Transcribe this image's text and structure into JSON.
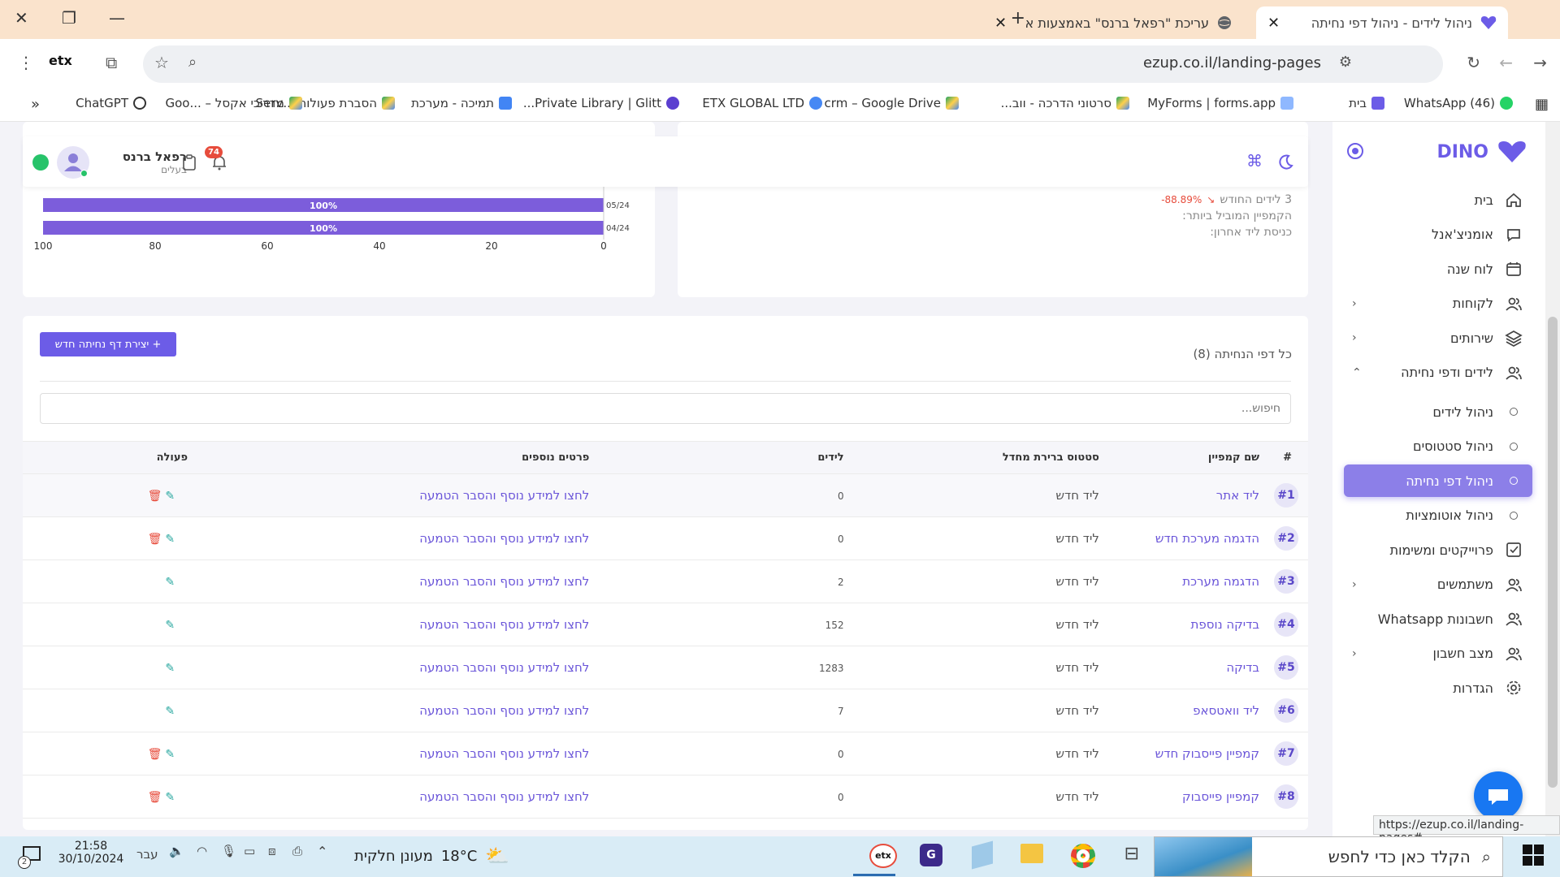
{
  "browser": {
    "tabs": [
      {
        "title": "ניהול לידים - ניהול דפי נחיתה",
        "active": true
      },
      {
        "title": "עריכת \"רפאל ברנס\" באמצעות א",
        "active": false
      }
    ],
    "url": "ezup.co.il/landing-pages",
    "bookmarks": [
      "(46) WhatsApp",
      "בית",
      "MyForms | forms.app",
      "סרטוני הדרכה - ווב...",
      "crm – Google Drive",
      "ETX GLOBAL LTD",
      "Private Library | Glitt...",
      "תמיכה - מערכת",
      "הסברת פעולות ...Serv",
      "מדריכי אקסל – ...Goo",
      "ChatGPT"
    ],
    "status_url": "https://ezup.co.il/landing-pages#"
  },
  "sidebar": {
    "logo": "DINO",
    "items": [
      {
        "label": "בית",
        "icon": "home-icon",
        "chevron": false
      },
      {
        "label": "אומניצ'אנל",
        "icon": "chat-icon",
        "chevron": false
      },
      {
        "label": "לוח שנה",
        "icon": "calendar-icon",
        "chevron": false
      },
      {
        "label": "לקוחות",
        "icon": "users-icon",
        "chevron": true
      },
      {
        "label": "שירותים",
        "icon": "layers-icon",
        "chevron": true
      },
      {
        "label": "לידים ודפי נחיתה",
        "icon": "users-icon",
        "chevron": true,
        "open": true
      }
    ],
    "subitems": [
      {
        "label": "ניהול לידים",
        "active": false
      },
      {
        "label": "ניהול סטטוסים",
        "active": false
      },
      {
        "label": "ניהול דפי נחיתה",
        "active": true
      },
      {
        "label": "ניהול אוטומציות",
        "active": false
      }
    ],
    "items2": [
      {
        "label": "פרוייקטים ומשימות",
        "icon": "checkbox-icon",
        "chevron": false
      },
      {
        "label": "משתמשים",
        "icon": "users-icon",
        "chevron": true
      },
      {
        "label": "חשבונות Whatsapp",
        "icon": "users-icon",
        "chevron": false
      },
      {
        "label": "מצב חשבון",
        "icon": "users-icon",
        "chevron": true
      },
      {
        "label": "הגדרות",
        "icon": "gear-icon",
        "chevron": false
      }
    ]
  },
  "header": {
    "user_name": "רפאל ברנס",
    "user_role": "בעלים",
    "notifications": "74"
  },
  "stats": {
    "line1": "3 לידים החודש",
    "change": "-88.89%",
    "line2": "הקמפיין המוביל ביותר:",
    "line3": "כניסת ליד אחרון:"
  },
  "chart_data": {
    "type": "bar",
    "orientation": "horizontal",
    "categories": [
      "05/24",
      "04/24"
    ],
    "values": [
      100,
      100
    ],
    "data_labels": [
      "100%",
      "100%"
    ],
    "xlim": [
      100,
      0
    ],
    "x_ticks": [
      "100",
      "80",
      "60",
      "40",
      "20",
      "0"
    ]
  },
  "landing": {
    "title": "כל דפי הנחיתה (8)",
    "create_button": "+ יצירת דף נחיתה חדש",
    "search_placeholder": "חיפוש...",
    "columns": [
      "#",
      "שם קמפיין",
      "סטטוס ברירת מחדל",
      "לידים",
      "פרטים נוספים",
      "פעולה"
    ],
    "rows": [
      {
        "id": "#1",
        "name": "ליד אתר",
        "status": "ליד חדש",
        "leads": "0",
        "details": "לחצו למידע נוסף והסבר הטמעה",
        "delete": true
      },
      {
        "id": "#2",
        "name": "הדגמה מערכת חדש",
        "status": "ליד חדש",
        "leads": "0",
        "details": "לחצו למידע נוסף והסבר הטמעה",
        "delete": true
      },
      {
        "id": "#3",
        "name": "הדגמה מערכת",
        "status": "ליד חדש",
        "leads": "2",
        "details": "לחצו למידע נוסף והסבר הטמעה",
        "delete": false
      },
      {
        "id": "#4",
        "name": "בדיקה נוספת",
        "status": "ליד חדש",
        "leads": "152",
        "details": "לחצו למידע נוסף והסבר הטמעה",
        "delete": false
      },
      {
        "id": "#5",
        "name": "בדיקה",
        "status": "ליד חדש",
        "leads": "1283",
        "details": "לחצו למידע נוסף והסבר הטמעה",
        "delete": false
      },
      {
        "id": "#6",
        "name": "ליד וואטסאפ",
        "status": "ליד חדש",
        "leads": "7",
        "details": "לחצו למידע נוסף והסבר הטמעה",
        "delete": false
      },
      {
        "id": "#7",
        "name": "קמפיין פייסבוק חדש",
        "status": "ליד חדש",
        "leads": "0",
        "details": "לחצו למידע נוסף והסבר הטמעה",
        "delete": true
      },
      {
        "id": "#8",
        "name": "קמפיין פייסבוק",
        "status": "ליד חדש",
        "leads": "0",
        "details": "לחצו למידע נוסף והסבר הטמעה",
        "delete": true
      }
    ]
  },
  "taskbar": {
    "search_placeholder": "הקלד כאן כדי לחפש",
    "weather": "מעונן חלקית",
    "temp": "18°C",
    "lang": "עבר",
    "time": "21:58",
    "date": "30/10/2024",
    "notif_count": "2"
  },
  "colors": {
    "accent": "#7c5ddb",
    "active_menu": "#8c7fe8",
    "tabbar": "#fae3cc",
    "taskbar": "#d9ecf6",
    "negative": "#e74c3c"
  }
}
